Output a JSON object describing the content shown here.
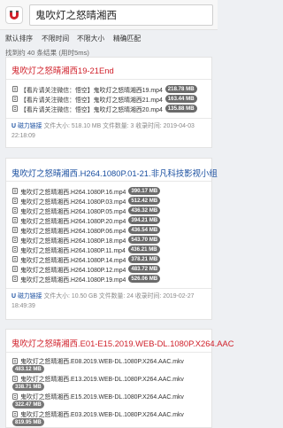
{
  "search": {
    "value": "鬼吹灯之怒晴湘西",
    "placeholder": ""
  },
  "filters": [
    "默认排序",
    "不限时间",
    "不限大小",
    "精确匹配"
  ],
  "stats": "找到约 40 条结果 (用时5ms)",
  "results": [
    {
      "title": "鬼吹灯之怒晴湘西19-21End",
      "files": [
        {
          "name": "【看片请关注微信：悟空】鬼吹灯之怒晴湘西19.mp4",
          "size": "218.78 MB"
        },
        {
          "name": "【看片请关注微信：悟空】鬼吹灯之怒晴湘西21.mp4",
          "size": "163.44 MB"
        },
        {
          "name": "【看片请关注微信：悟空】鬼吹灯之怒晴湘西20.mp4",
          "size": "135.88 MB"
        }
      ],
      "magnet": "磁力链接",
      "meta": "文件大小: 518.10 MB 文件数量: 3 收录时间: 2019-04-03 22:18:09"
    },
    {
      "title": "鬼吹灯之怒晴湘西.H264.1080P.01-21.非凡科技影视小组",
      "files": [
        {
          "name": "鬼吹灯之怒晴湘西.H264.1080P.16.mp4",
          "size": "390.17 MB"
        },
        {
          "name": "鬼吹灯之怒晴湘西.H264.1080P.03.mp4",
          "size": "512.42 MB"
        },
        {
          "name": "鬼吹灯之怒晴湘西.H264.1080P.05.mp4",
          "size": "436.32 MB"
        },
        {
          "name": "鬼吹灯之怒晴湘西.H264.1080P.20.mp4",
          "size": "394.21 MB"
        },
        {
          "name": "鬼吹灯之怒晴湘西.H264.1080P.06.mp4",
          "size": "436.54 MB"
        },
        {
          "name": "鬼吹灯之怒晴湘西.H264.1080P.18.mp4",
          "size": "543.70 MB"
        },
        {
          "name": "鬼吹灯之怒晴湘西.H264.1080P.11.mp4",
          "size": "436.21 MB"
        },
        {
          "name": "鬼吹灯之怒晴湘西.H264.1080P.14.mp4",
          "size": "378.21 MB"
        },
        {
          "name": "鬼吹灯之怒晴湘西.H264.1080P.12.mp4",
          "size": "483.72 MB"
        },
        {
          "name": "鬼吹灯之怒晴湘西.H264.1080P.19.mp4",
          "size": "526.06 MB"
        }
      ],
      "magnet": "磁力链接",
      "meta": "文件大小: 10.50 GB 文件数量: 24 收录时间: 2019-02-27 18:49:39"
    },
    {
      "title": "鬼吹灯之怒晴湘西.E01-E15.2019.WEB-DL.1080P.X264.AAC",
      "files": [
        {
          "name": "鬼吹灯之怒晴湘西.E08.2019.WEB-DL.1080P.X264.AAC.mkv",
          "size": "483.12 MB"
        },
        {
          "name": "鬼吹灯之怒晴湘西.E13.2019.WEB-DL.1080P.X264.AAC.mkv",
          "size": "338.71 MB"
        },
        {
          "name": "鬼吹灯之怒晴湘西.E15.2019.WEB-DL.1080P.X264.AAC.mkv",
          "size": "322.47 MB"
        },
        {
          "name": "鬼吹灯之怒晴湘西.E03.2019.WEB-DL.1080P.X264.AAC.mkv",
          "size": "819.95 MB"
        }
      ]
    }
  ]
}
